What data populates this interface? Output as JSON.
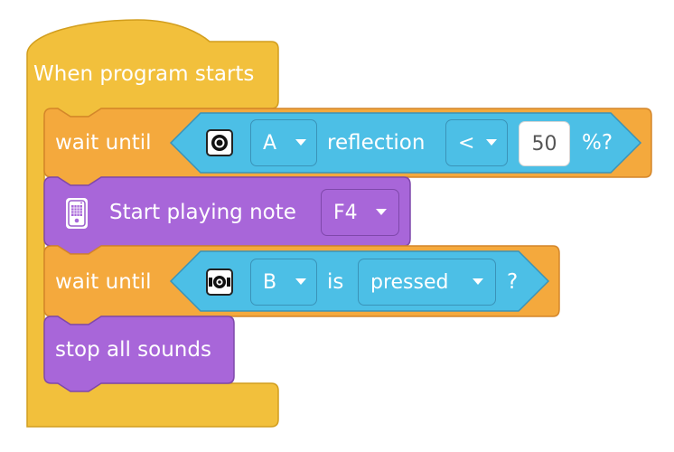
{
  "colors": {
    "events_block": "#f2c03c",
    "control_block": "#f4a93d",
    "sensor_reporter": "#4cbfe6",
    "sound_block": "#a866d9"
  },
  "blocks": {
    "hat": {
      "label": "When program starts"
    },
    "wait1": {
      "label": "wait until",
      "sensor_icon": "color-sensor-icon",
      "port": "A",
      "word": "reflection",
      "operator": "<",
      "value": "50",
      "suffix": "%?"
    },
    "note": {
      "icon": "speaker-hub-icon",
      "label": "Start playing note",
      "note": "F4"
    },
    "wait2": {
      "label": "wait until",
      "sensor_icon": "force-sensor-icon",
      "port": "B",
      "word": "is",
      "state": "pressed",
      "suffix": "?"
    },
    "stop": {
      "label": "stop all sounds"
    }
  }
}
